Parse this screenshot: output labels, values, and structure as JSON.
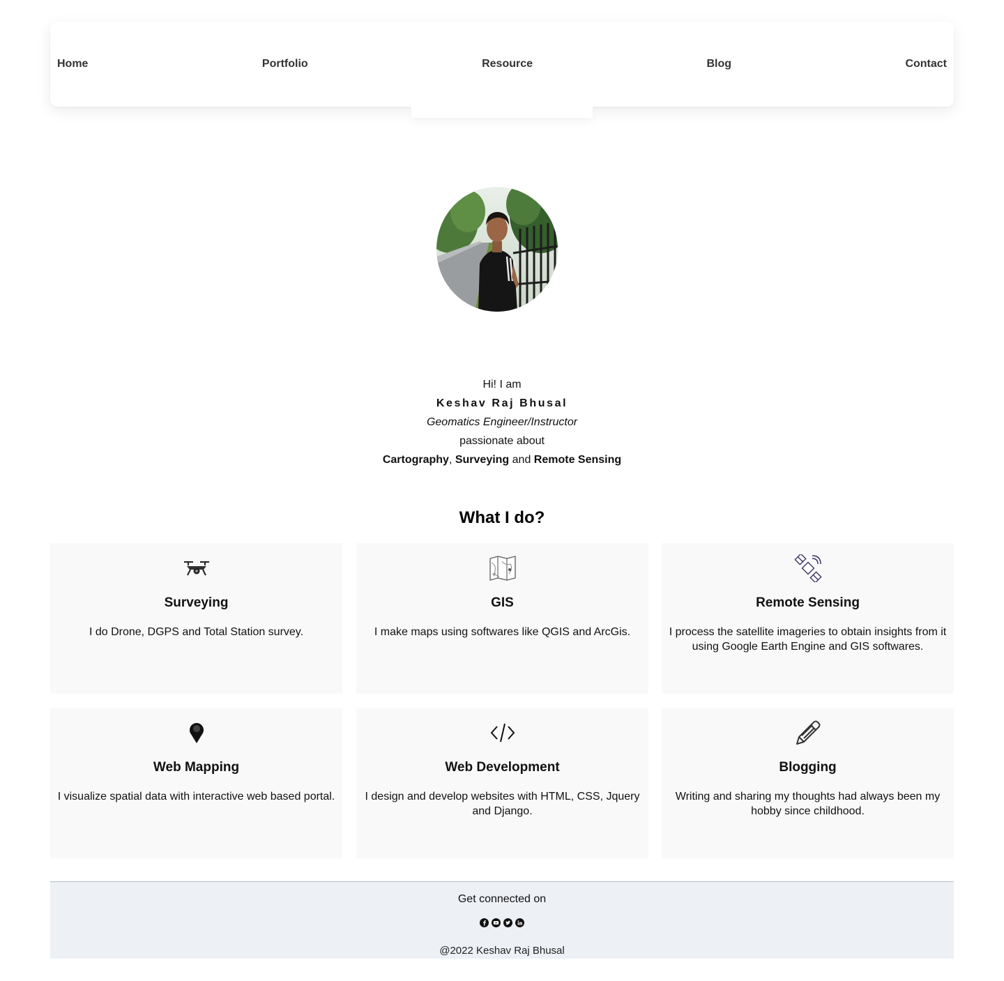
{
  "nav": {
    "items": [
      "Home",
      "Portfolio",
      "Resource",
      "Blog",
      "Contact"
    ]
  },
  "intro": {
    "greeting": "Hi! I am",
    "name": "Keshav Raj Bhusal",
    "role": "Geomatics Engineer/Instructor",
    "passion": "passionate about",
    "interest_1": "Cartography",
    "sep_1": ", ",
    "interest_2": "Surveying",
    "sep_2": " and ",
    "interest_3": "Remote Sensing"
  },
  "services": {
    "title": "What I do?",
    "items": [
      {
        "icon": "drone-icon",
        "title": "Surveying",
        "desc": "I do Drone, DGPS and Total Station survey."
      },
      {
        "icon": "map-icon",
        "title": "GIS",
        "desc": "I make maps using softwares like QGIS and ArcGis."
      },
      {
        "icon": "satellite-icon",
        "title": "Remote Sensing",
        "desc": "I process the satellite imageries to obtain insights from it using Google Earth Engine and GIS softwares."
      },
      {
        "icon": "map-pin-icon",
        "title": "Web Mapping",
        "desc": "I visualize spatial data with interactive web based portal."
      },
      {
        "icon": "code-icon",
        "title": "Web Development",
        "desc": "I design and develop websites with HTML, CSS, Jquery and Django."
      },
      {
        "icon": "pencil-icon",
        "title": "Blogging",
        "desc": "Writing and sharing my thoughts had always been my hobby since childhood."
      }
    ]
  },
  "footer": {
    "connect": "Get connected on",
    "socials": [
      "facebook-icon",
      "youtube-icon",
      "twitter-icon",
      "linkedin-icon"
    ],
    "copyright": "@2022 Keshav Raj Bhusal"
  }
}
